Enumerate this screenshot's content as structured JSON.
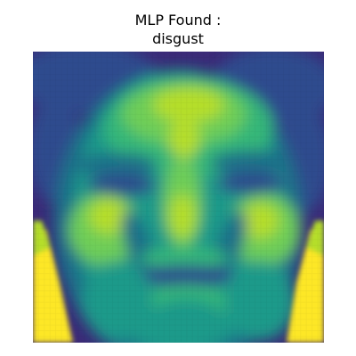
{
  "figure": {
    "title_line1": "MLP Found :",
    "title_line2": "disgust"
  },
  "image": {
    "subject": "face-portrait-heatmap",
    "colormap": "viridis",
    "colors": {
      "dark_purple": "#3b2a78",
      "deep_blue": "#2f4b8e",
      "teal_dark": "#1f6f8a",
      "teal": "#1f9a8a",
      "green": "#35b779",
      "light_green": "#6ece58",
      "yellow_green": "#b5de2b",
      "yellow": "#fde725"
    }
  }
}
